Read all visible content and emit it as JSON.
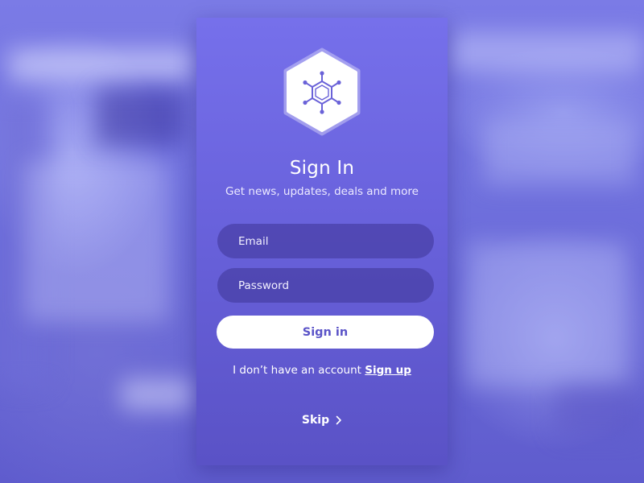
{
  "colors": {
    "background": "#6563d6",
    "card_top": "#7670eb",
    "card_bottom": "#5a52c6",
    "field_fill": "#4a3fa0",
    "button_fill": "#ffffff",
    "button_text": "#5b54c8",
    "logo_icon": "#6a62d8"
  },
  "logo": {
    "icon": "molecule-hexagon-icon"
  },
  "header": {
    "title": "Sign In",
    "subtitle": "Get news, updates, deals and more"
  },
  "form": {
    "email_placeholder": "Email",
    "password_placeholder": "Password",
    "signin_label": "Sign in"
  },
  "account": {
    "prompt": "I don’t have an account",
    "signup_label": "Sign up"
  },
  "skip": {
    "label": "Skip",
    "icon": "chevron-right-icon"
  }
}
